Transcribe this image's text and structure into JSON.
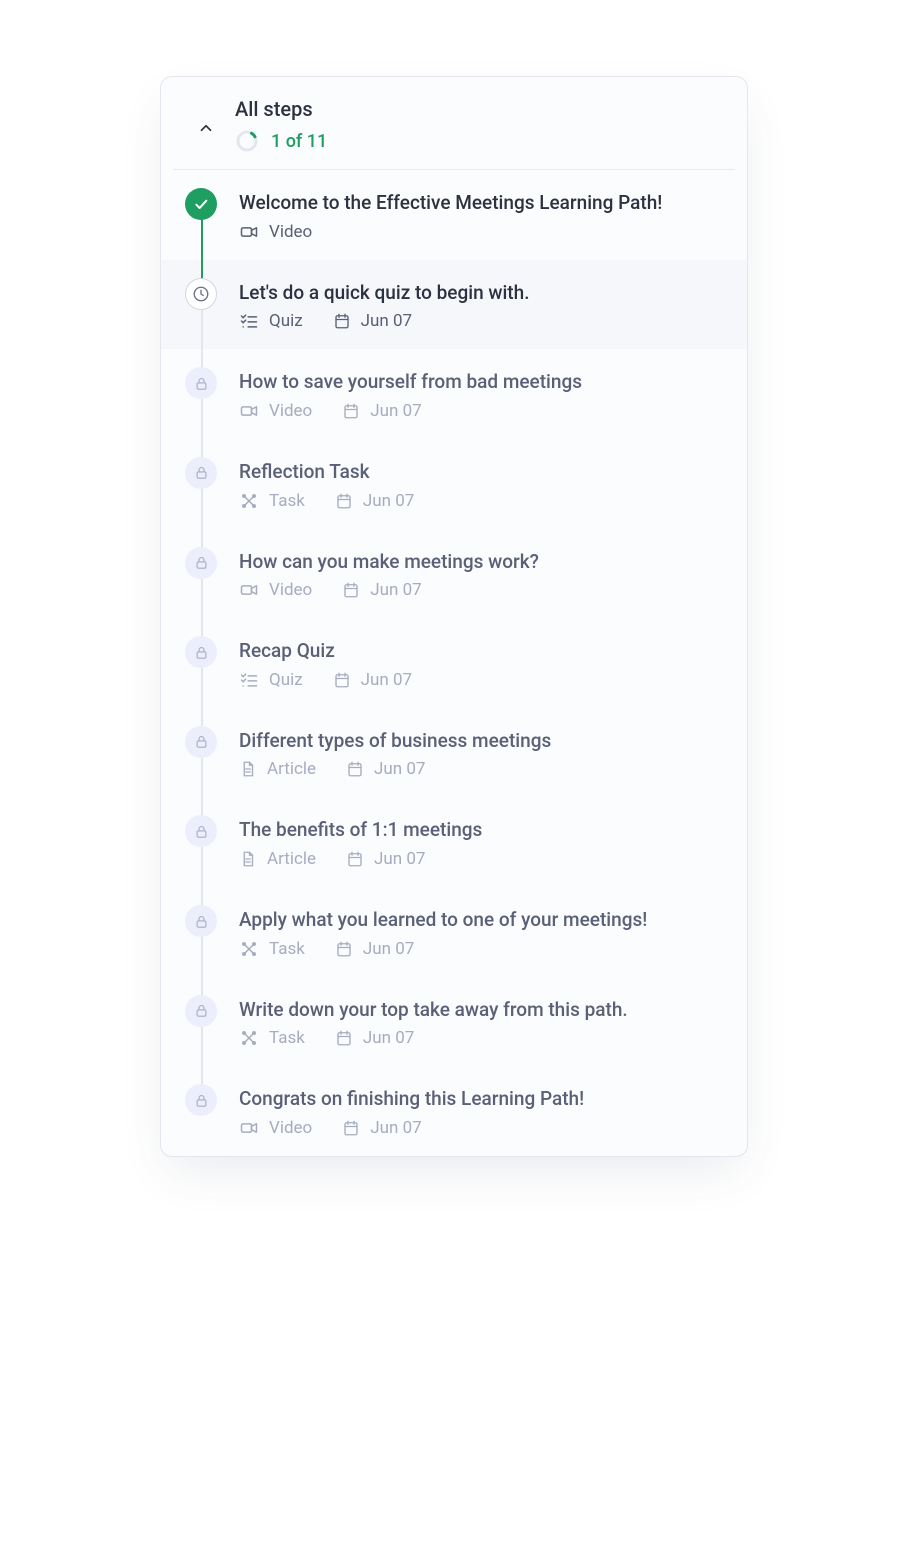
{
  "header": {
    "title": "All steps",
    "progress_text": "1 of 11",
    "completed": 1,
    "total": 11
  },
  "steps": [
    {
      "title": "Welcome to the Effective Meetings Learning Path!",
      "type": "Video",
      "date": null,
      "state": "completed"
    },
    {
      "title": "Let's do a quick quiz to begin with.",
      "type": "Quiz",
      "date": "Jun 07",
      "state": "current"
    },
    {
      "title": "How to save yourself from bad meetings",
      "type": "Video",
      "date": "Jun 07",
      "state": "locked"
    },
    {
      "title": "Reflection Task",
      "type": "Task",
      "date": "Jun 07",
      "state": "locked"
    },
    {
      "title": "How can you make meetings work?",
      "type": "Video",
      "date": "Jun 07",
      "state": "locked"
    },
    {
      "title": "Recap Quiz",
      "type": "Quiz",
      "date": "Jun 07",
      "state": "locked"
    },
    {
      "title": "Different types of business meetings",
      "type": "Article",
      "date": "Jun 07",
      "state": "locked"
    },
    {
      "title": "The benefits of 1:1 meetings",
      "type": "Article",
      "date": "Jun 07",
      "state": "locked"
    },
    {
      "title": "Apply what you learned to one of your meetings!",
      "type": "Task",
      "date": "Jun 07",
      "state": "locked"
    },
    {
      "title": "Write down your top take away from this path.",
      "type": "Task",
      "date": "Jun 07",
      "state": "locked"
    },
    {
      "title": "Congrats on finishing this Learning Path!",
      "type": "Video",
      "date": "Jun 07",
      "state": "locked"
    }
  ]
}
